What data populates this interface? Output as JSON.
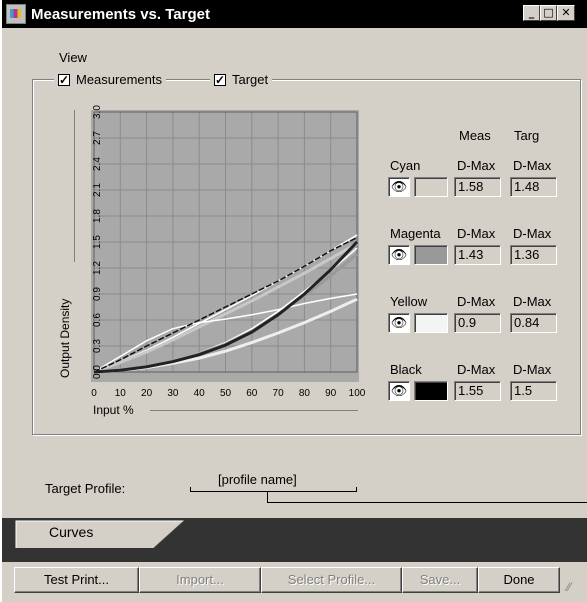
{
  "window": {
    "title": "Measurements vs. Target"
  },
  "view": {
    "label": "View",
    "measurements": {
      "label": "Measurements",
      "checked": true
    },
    "target": {
      "label": "Target",
      "checked": true
    }
  },
  "chart_data": {
    "type": "line",
    "title": "",
    "xlabel": "Input %",
    "ylabel": "Output Density",
    "xlim": [
      0,
      100
    ],
    "ylim": [
      0,
      3.0
    ],
    "grid": true,
    "x": [
      0,
      10,
      20,
      30,
      40,
      50,
      60,
      70,
      80,
      90,
      100
    ],
    "x_ticks": [
      "0",
      "10",
      "20",
      "30",
      "40",
      "50",
      "60",
      "70",
      "80",
      "90",
      "100"
    ],
    "y_ticks": [
      "0.0",
      "0.3",
      "0.6",
      "0.9",
      "1.2",
      "1.5",
      "1.8",
      "2.1",
      "2.4",
      "2.7",
      "3.0"
    ],
    "series": [
      {
        "ink": "Cyan",
        "kind": "meas",
        "color": "#ffffff",
        "values": [
          0,
          0.12,
          0.25,
          0.4,
          0.56,
          0.72,
          0.88,
          1.05,
          1.22,
          1.4,
          1.58
        ]
      },
      {
        "ink": "Cyan",
        "kind": "targ",
        "color": "#c8c8c8",
        "values": [
          0,
          0.11,
          0.23,
          0.37,
          0.52,
          0.67,
          0.82,
          0.98,
          1.14,
          1.31,
          1.48
        ]
      },
      {
        "ink": "Magenta",
        "kind": "meas",
        "color": "#ffffff",
        "values": [
          0,
          0.02,
          0.06,
          0.13,
          0.22,
          0.34,
          0.5,
          0.7,
          0.93,
          1.17,
          1.43
        ]
      },
      {
        "ink": "Magenta",
        "kind": "targ",
        "color": "#999999",
        "values": [
          0,
          0.02,
          0.06,
          0.12,
          0.21,
          0.32,
          0.47,
          0.66,
          0.88,
          1.11,
          1.36
        ]
      },
      {
        "ink": "Yellow",
        "kind": "meas",
        "color": "#ffffff",
        "values": [
          0,
          0.18,
          0.36,
          0.5,
          0.57,
          0.61,
          0.66,
          0.72,
          0.79,
          0.85,
          0.9
        ]
      },
      {
        "ink": "Yellow",
        "kind": "targ",
        "color": "#eeeeee",
        "values": [
          0,
          0.02,
          0.05,
          0.1,
          0.16,
          0.24,
          0.34,
          0.45,
          0.57,
          0.7,
          0.84
        ]
      },
      {
        "ink": "Black",
        "kind": "meas",
        "color": "#111111",
        "values": [
          0,
          0.14,
          0.3,
          0.45,
          0.6,
          0.75,
          0.9,
          1.05,
          1.22,
          1.4,
          1.55
        ]
      },
      {
        "ink": "Black",
        "kind": "targ",
        "color": "#222222",
        "values": [
          0,
          0.02,
          0.06,
          0.12,
          0.2,
          0.31,
          0.46,
          0.66,
          0.9,
          1.18,
          1.5
        ]
      }
    ]
  },
  "inks": {
    "col_meas": "Meas",
    "col_targ": "Targ",
    "list": [
      {
        "name": "Cyan",
        "meas_label": "D-Max",
        "targ_label": "D-Max",
        "meas": "1.58",
        "targ": "1.48",
        "swatch": "#d4d0c8",
        "eye": "👁"
      },
      {
        "name": "Magenta",
        "meas_label": "D-Max",
        "targ_label": "D-Max",
        "meas": "1.43",
        "targ": "1.36",
        "swatch": "#999999",
        "eye": "👁"
      },
      {
        "name": "Yellow",
        "meas_label": "D-Max",
        "targ_label": "D-Max",
        "meas": "0.9",
        "targ": "0.84",
        "swatch": "#f4f4f4",
        "eye": "👁"
      },
      {
        "name": "Black",
        "meas_label": "D-Max",
        "targ_label": "D-Max",
        "meas": "1.55",
        "targ": "1.5",
        "swatch": "#000000",
        "eye": "👁"
      }
    ]
  },
  "target_profile": {
    "label": "Target Profile:",
    "value": "[profile name]"
  },
  "tabs": [
    {
      "label": "Curves",
      "active": true
    }
  ],
  "buttons": {
    "test_print": "Test Print...",
    "import": "Import...",
    "select_profile": "Select Profile...",
    "save": "Save...",
    "done": "Done"
  }
}
